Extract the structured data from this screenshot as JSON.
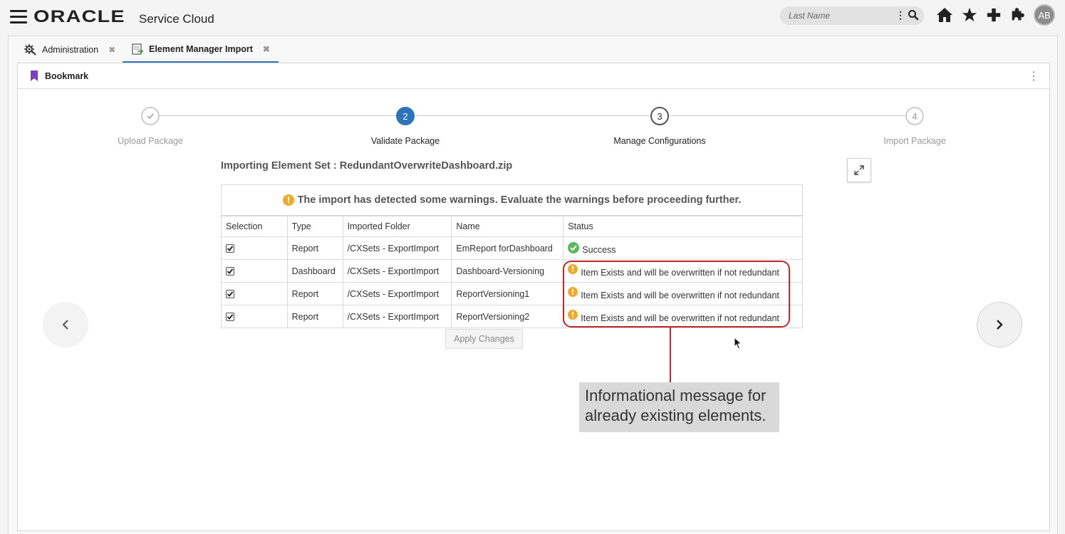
{
  "header": {
    "brand": "ORACLE",
    "product": "Service Cloud",
    "search_placeholder": "Last Name",
    "avatar_initials": "AB"
  },
  "tabs": [
    {
      "label": "Administration",
      "icon": "administration-gear-icon",
      "active": false
    },
    {
      "label": "Element Manager Import",
      "icon": "import-document-icon",
      "active": true
    }
  ],
  "bookmark": {
    "label": "Bookmark"
  },
  "steps": [
    {
      "number": "",
      "label": "Upload Package",
      "state": "done"
    },
    {
      "number": "2",
      "label": "Validate Package",
      "state": "current"
    },
    {
      "number": "3",
      "label": "Manage Configurations",
      "state": "next"
    },
    {
      "number": "4",
      "label": "Import Package",
      "state": "pending"
    }
  ],
  "importing_title": "Importing Element Set : RedundantOverwriteDashboard.zip",
  "warning_message": "The import has detected some warnings. Evaluate the warnings before proceeding further.",
  "table": {
    "columns": [
      "Selection",
      "Type",
      "Imported Folder",
      "Name",
      "Status"
    ],
    "rows": [
      {
        "selected": true,
        "type": "Report",
        "folder": "/CXSets - ExportImport",
        "name": "EmReport forDashboard",
        "status": "Success",
        "status_kind": "success"
      },
      {
        "selected": true,
        "type": "Dashboard",
        "folder": "/CXSets - ExportImport",
        "name": "Dashboard-Versioning",
        "status": "Item Exists and will be overwritten if not redundant",
        "status_kind": "warning"
      },
      {
        "selected": true,
        "type": "Report",
        "folder": "/CXSets - ExportImport",
        "name": "ReportVersioning1",
        "status": "Item Exists and will be overwritten if not redundant",
        "status_kind": "warning"
      },
      {
        "selected": true,
        "type": "Report",
        "folder": "/CXSets - ExportImport",
        "name": "ReportVersioning2",
        "status": "Item Exists and will be overwritten if not redundant",
        "status_kind": "warning"
      }
    ]
  },
  "apply_button": "Apply Changes",
  "callout": {
    "line1": "Informational message for",
    "line2": "already existing elements."
  },
  "colors": {
    "accent": "#2f74b8",
    "warning": "#f0a92b",
    "success": "#5cb85c",
    "highlight": "#c1272d"
  }
}
